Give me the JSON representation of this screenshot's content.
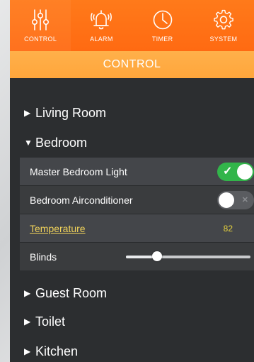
{
  "nav": {
    "items": [
      {
        "label": "CONTROL",
        "icon": "sliders-icon"
      },
      {
        "label": "ALARM",
        "icon": "bell-icon"
      },
      {
        "label": "TIMER",
        "icon": "clock-icon"
      },
      {
        "label": "SYSTEM",
        "icon": "gear-icon"
      }
    ],
    "active": "CONTROL"
  },
  "section": {
    "title": "CONTROL"
  },
  "rooms": [
    {
      "name": "Living Room",
      "expanded": false
    },
    {
      "name": "Bedroom",
      "expanded": true
    },
    {
      "name": "Guest Room",
      "expanded": false
    },
    {
      "name": "Toilet",
      "expanded": false
    },
    {
      "name": "Kitchen",
      "expanded": false
    }
  ],
  "bedroom": {
    "light": {
      "label": "Master Bedroom Light",
      "on": true
    },
    "aircon": {
      "label": "Bedroom Airconditioner",
      "on": false
    },
    "temperature": {
      "label": "Temperature",
      "value": "82"
    },
    "blinds": {
      "label": "Blinds",
      "level": 0.23
    }
  },
  "glyphs": {
    "collapsed": "▶",
    "expanded": "▼",
    "toggle_on": "✓",
    "toggle_off": "✕"
  },
  "colors": {
    "nav_orange": "#ff6a12",
    "header_orange": "#ffa63c",
    "panel_bg": "#2c2e30",
    "toggle_on": "#32b54a",
    "link_yellow": "#f0d25a"
  }
}
